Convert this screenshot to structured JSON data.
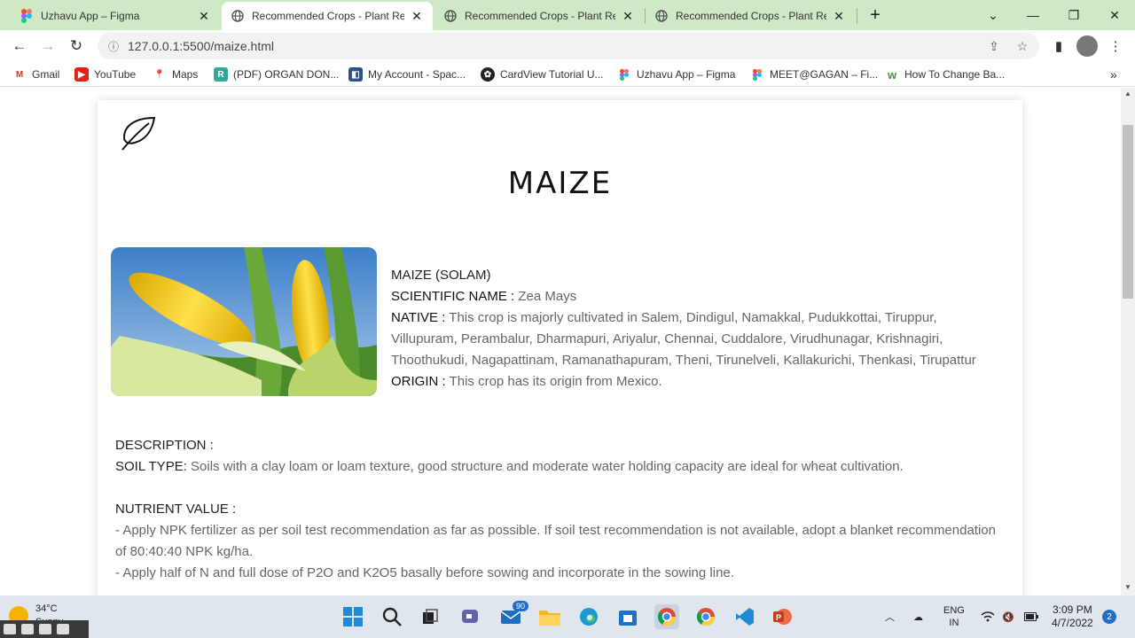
{
  "browser": {
    "tabs": [
      {
        "title": "Uzhavu App – Figma",
        "icon": "figma-icon"
      },
      {
        "title": "Recommended Crops - Plant Rec",
        "icon": "globe-icon"
      },
      {
        "title": "Recommended Crops - Plant Rec",
        "icon": "globe-icon"
      },
      {
        "title": "Recommended Crops - Plant Rec",
        "icon": "globe-icon"
      }
    ],
    "url": "127.0.0.1:5500/maize.html",
    "bookmarks": [
      {
        "label": "Gmail",
        "icon": "gmail-icon"
      },
      {
        "label": "YouTube",
        "icon": "youtube-icon"
      },
      {
        "label": "Maps",
        "icon": "maps-icon"
      },
      {
        "label": "(PDF) ORGAN DON...",
        "icon": "researchgate-icon"
      },
      {
        "label": "My Account - Spac...",
        "icon": "account-icon"
      },
      {
        "label": "CardView Tutorial U...",
        "icon": "cardview-icon"
      },
      {
        "label": "Uzhavu App – Figma",
        "icon": "figma-icon"
      },
      {
        "label": "MEET@GAGAN – Fi...",
        "icon": "figma-icon"
      },
      {
        "label": "How To Change Ba...",
        "icon": "w-icon"
      }
    ],
    "more_bookmarks": "»"
  },
  "page": {
    "title": "MAIZE",
    "crop_name": "MAIZE (SOLAM)",
    "scientific_label": "SCIENTIFIC NAME :",
    "scientific_value": " Zea Mays",
    "native_label": "NATIVE :",
    "native_value": " This crop is majorly cultivated in Salem, Dindigul, Namakkal, Pudukkottai, Tiruppur, Villupuram, Perambalur, Dharmapuri, Ariyalur, Chennai, Cuddalore, Virudhunagar, Krishnagiri, Thoothukudi, Nagapattinam, Ramanathapuram, Theni, Tirunelveli, Kallakurichi, Thenkasi, Tirupattur",
    "origin_label": "ORIGIN :",
    "origin_value": " This crop has its origin from Mexico.",
    "description_label": "DESCRIPTION :",
    "soil_label": "SOIL TYPE:",
    "soil_value": " Soils with a clay loam or loam texture, good structure and moderate water holding capacity are ideal for wheat cultivation.",
    "nutrient_label": "NUTRIENT VALUE :",
    "nutrient_1": "- Apply NPK fertilizer as per soil test recommendation as far as possible. If soil test recommendation is not available, adopt a blanket recommendation of 80:40:40 NPK kg/ha.",
    "nutrient_2": "- Apply half of N and full dose of P2O and K2O5 basally before sowing and incorporate in the sowing line."
  },
  "taskbar": {
    "temperature": "34°C",
    "condition": "Sunny",
    "mail_badge": "90",
    "lang_1": "ENG",
    "lang_2": "IN",
    "time": "3:09 PM",
    "date": "4/7/2022",
    "notifications": "2"
  },
  "colors": {
    "tab_strip": "#cfe8c6",
    "taskbar": "#dfe6ee",
    "accent": "#1f6fc5"
  }
}
